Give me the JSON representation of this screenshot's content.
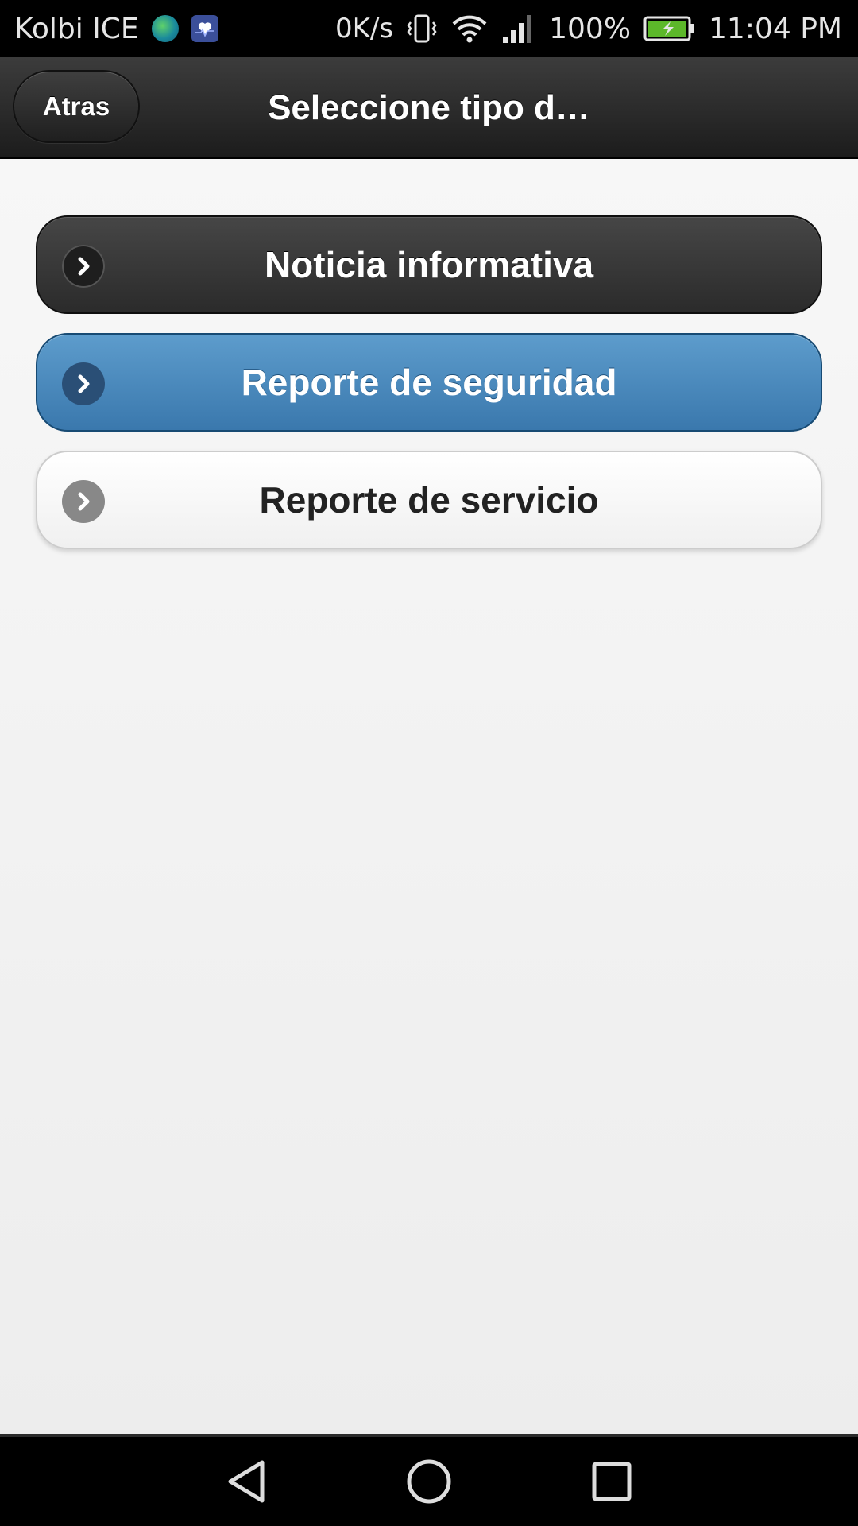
{
  "status_bar": {
    "carrier": "Kolbi ICE",
    "net_speed": "0K/s",
    "battery_percent": "100%",
    "time": "11:04 PM",
    "icons": [
      "globe-icon",
      "health-icon",
      "vibrate-icon",
      "wifi-icon",
      "signal-icon",
      "battery-charging-icon"
    ]
  },
  "header": {
    "back_label": "Atras",
    "title": "Seleccione tipo d…"
  },
  "options": [
    {
      "label": "Noticia informativa",
      "style": "dark",
      "icon": "chevron-right-icon"
    },
    {
      "label": "Reporte de seguridad",
      "style": "blue",
      "icon": "chevron-right-icon"
    },
    {
      "label": "Reporte de servicio",
      "style": "light",
      "icon": "chevron-right-icon"
    }
  ],
  "nav_bar": {
    "icons": [
      "nav-back-icon",
      "nav-home-icon",
      "nav-recents-icon"
    ]
  },
  "colors": {
    "header_bg": "#2a2a2a",
    "dark_button": "#333333",
    "blue_button": "#4a89bd",
    "light_button": "#f7f7f7",
    "battery_fill": "#5cb82a"
  }
}
